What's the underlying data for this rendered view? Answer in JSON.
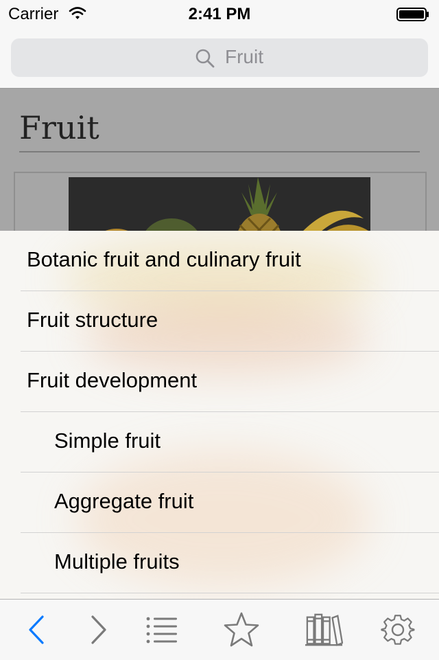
{
  "status_bar": {
    "carrier": "Carrier",
    "time": "2:41 PM"
  },
  "search": {
    "value": "Fruit",
    "icon": "search-icon"
  },
  "article": {
    "title": "Fruit"
  },
  "toc": {
    "items": [
      {
        "label": "Botanic fruit and culinary fruit",
        "level": 1
      },
      {
        "label": "Fruit structure",
        "level": 1
      },
      {
        "label": "Fruit development",
        "level": 1
      },
      {
        "label": "Simple fruit",
        "level": 2
      },
      {
        "label": "Aggregate fruit",
        "level": 2
      },
      {
        "label": "Multiple fruits",
        "level": 2
      }
    ]
  },
  "toolbar": {
    "icons": [
      "back-icon",
      "forward-icon",
      "table-of-contents-icon",
      "bookmark-star-icon",
      "library-icon",
      "settings-gear-icon"
    ],
    "accent": "#0a7aff",
    "inactive": "#7a7a7a"
  },
  "colors": {
    "toc_background": "#f7f6f3",
    "dimmed_article": "#a6a6a6"
  }
}
